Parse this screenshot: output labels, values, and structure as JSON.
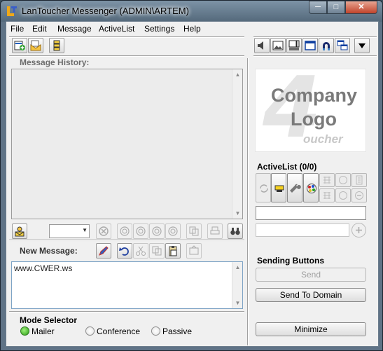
{
  "window": {
    "title": "LanToucher Messenger (ADMIN\\ARTEM)"
  },
  "caption_buttons": {
    "minimize": "─",
    "maximize": "□",
    "close": "✕"
  },
  "menu": [
    "File",
    "Edit",
    "Message",
    "ActiveList",
    "Settings",
    "Help"
  ],
  "history": {
    "label": "Message History:"
  },
  "new_message": {
    "label": "New Message:",
    "text": "www.CWER.ws"
  },
  "mode_selector": {
    "label": "Mode Selector",
    "options": [
      "Mailer",
      "Conference",
      "Passive"
    ],
    "selected": "Mailer"
  },
  "logo": {
    "line1": "Company",
    "line2": "Logo",
    "mark": "4",
    "sub": "oucher"
  },
  "active_list": {
    "label": "ActiveList (0/0)"
  },
  "sending": {
    "label": "Sending Buttons",
    "send": "Send",
    "send_to_domain": "Send To Domain"
  },
  "minimize_button": "Minimize",
  "colors": {
    "accent_green": "#2b9c14",
    "title_bar": "#5f7386",
    "panel": "#f0f0f0"
  }
}
